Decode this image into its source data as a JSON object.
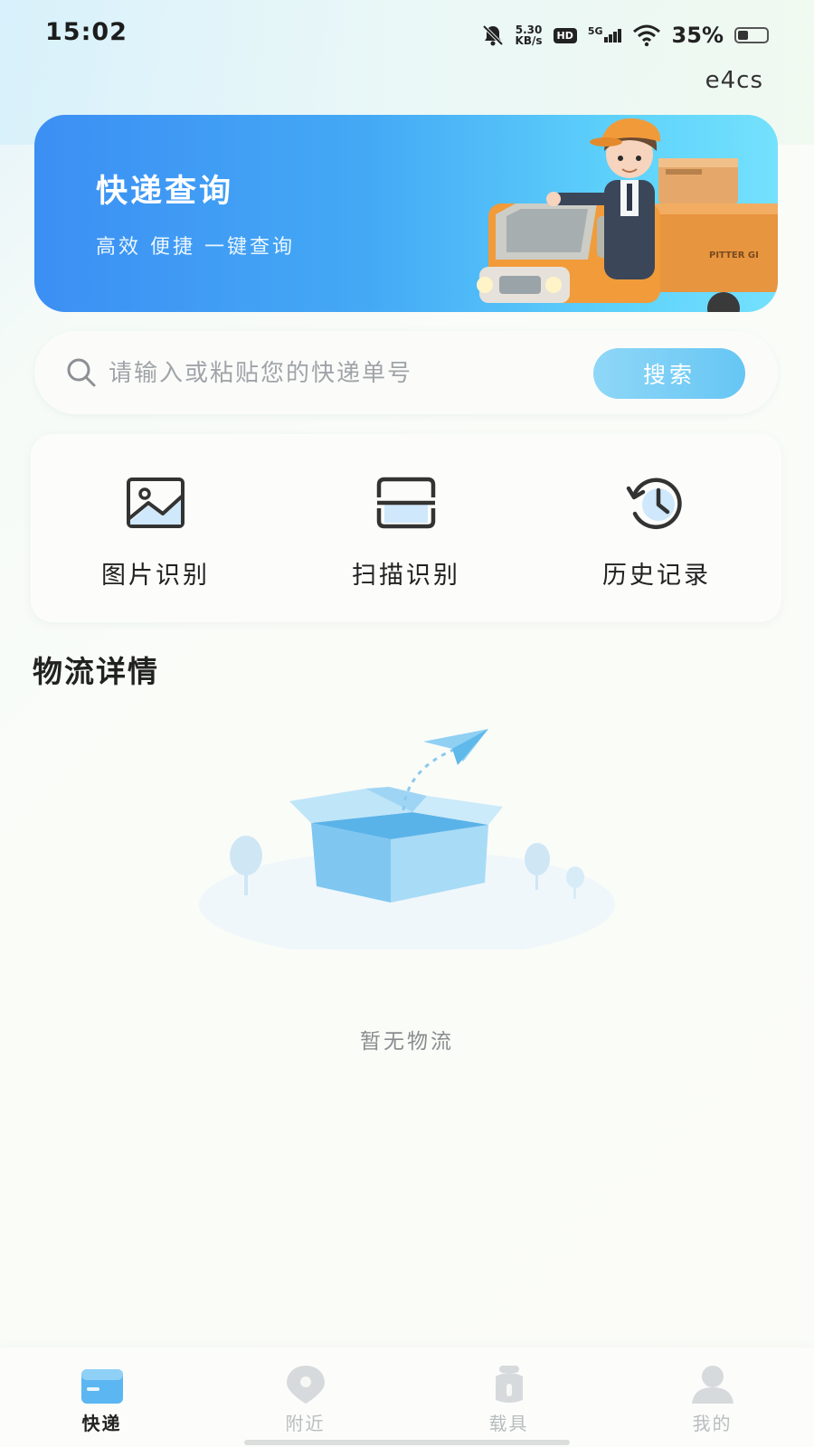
{
  "status_bar": {
    "time": "15:02",
    "net_speed_value": "5.30",
    "net_speed_unit": "KB/s",
    "hd_badge": "HD",
    "network_type": "5G",
    "battery_percent": "35%",
    "battery_level": 0.35,
    "icons": [
      "mute-bell-icon",
      "signal-icon",
      "wifi-icon",
      "battery-icon"
    ]
  },
  "header": {
    "user_tag": "e4cs"
  },
  "banner": {
    "title": "快递查询",
    "subtitle": "高效 便捷 一键查询",
    "truck_label": "PITTER GI"
  },
  "search": {
    "placeholder": "请输入或粘贴您的快递单号",
    "value": "",
    "button_label": "搜索"
  },
  "tools": [
    {
      "label": "图片识别",
      "icon": "image-icon"
    },
    {
      "label": "扫描识别",
      "icon": "scan-icon"
    },
    {
      "label": "历史记录",
      "icon": "history-icon"
    }
  ],
  "logistics": {
    "title": "物流详情",
    "empty_text": "暂无物流"
  },
  "bottom_nav": [
    {
      "label": "快递",
      "icon": "package-icon",
      "active": true
    },
    {
      "label": "附近",
      "icon": "location-icon",
      "active": false
    },
    {
      "label": "载具",
      "icon": "scooter-icon",
      "active": false
    },
    {
      "label": "我的",
      "icon": "profile-icon",
      "active": false
    }
  ],
  "colors": {
    "accent": "#44a9f5",
    "banner_start": "#3c8ff3",
    "banner_end": "#74e1fd",
    "search_button": "#66c6f4",
    "nav_active": "#222222",
    "nav_inactive": "#b9bcbe"
  }
}
